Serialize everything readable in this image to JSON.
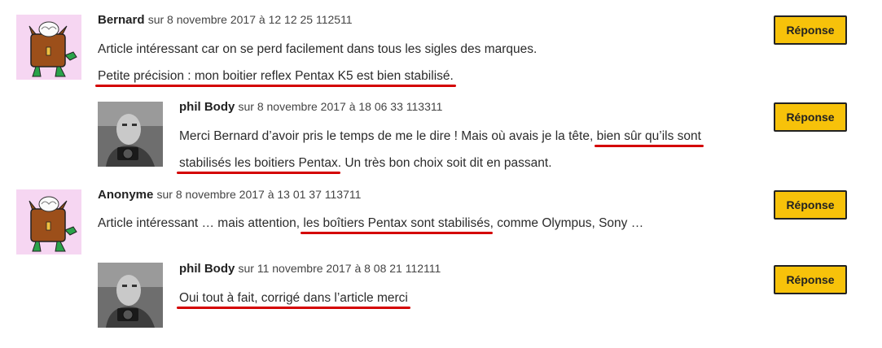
{
  "comments": [
    {
      "author": "Bernard",
      "date": "sur 8 novembre 2017 à 12 12 25 112511",
      "line1": "Article intéressant car on se perd facilement dans tous les sigles des marques.",
      "line2": "Petite précision : mon boitier reflex Pentax K5 est bien stabilisé.",
      "reply": "Réponse",
      "avatar": "monster-avatar"
    },
    {
      "author": "phil Body",
      "date": "sur 8 novembre 2017 à 18 06 33 113311",
      "line1_a": "Merci Bernard d’avoir pris le temps de me le dire ! Mais où avais je la tête, ",
      "line1_b": "bien sûr qu’ils sont",
      "line2_a": "stabilisés les boitiers Pentax",
      "line2_b": ". Un très bon choix soit dit en passant.",
      "reply": "Réponse",
      "avatar": "photographer-avatar"
    },
    {
      "author": "Anonyme",
      "date": "sur 8 novembre 2017 à 13 01 37 113711",
      "line1_a": "Article intéressant … mais attention, ",
      "line1_b": "les boîtiers Pentax sont stabilisés",
      "line1_c": ", comme Olympus, Sony …",
      "reply": "Réponse",
      "avatar": "monster-avatar"
    },
    {
      "author": "phil Body",
      "date": "sur 11 novembre 2017 à 8 08 21 112111",
      "line1": "Oui tout à fait, corrigé dans l’article merci",
      "reply": "Réponse",
      "avatar": "photographer-avatar"
    }
  ],
  "colors": {
    "button_bg": "#f7c20a",
    "highlight_underline": "#d40000",
    "avatar_bg": "#f6d6f2"
  }
}
